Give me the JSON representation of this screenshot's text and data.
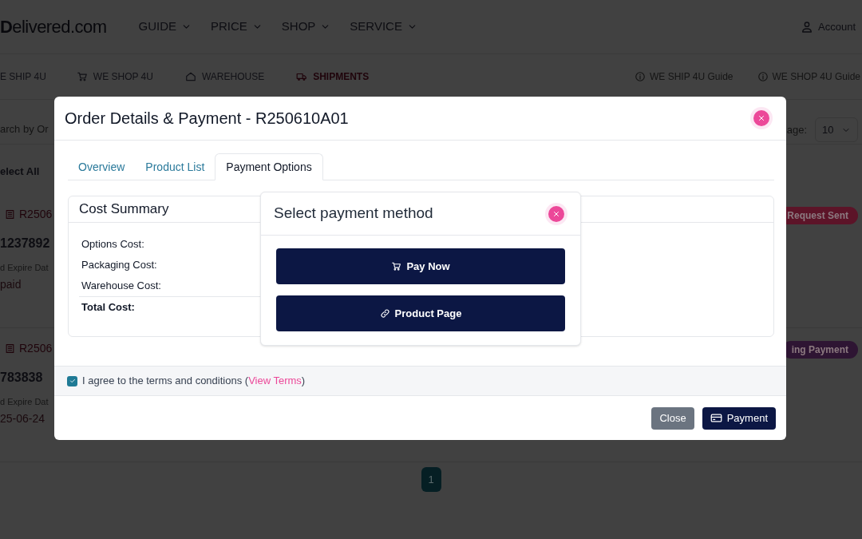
{
  "site_header": {
    "logo": "**D**elivered.com",
    "nav": [
      {
        "label": "GUIDE"
      },
      {
        "label": "PRICE"
      },
      {
        "label": "SHOP"
      },
      {
        "label": "SERVICE"
      }
    ],
    "account": "Account"
  },
  "sub_nav": {
    "items": [
      {
        "label": "E SHIP 4U",
        "selected": false
      },
      {
        "label": "WE SHOP 4U",
        "selected": false
      },
      {
        "label": "WAREHOUSE",
        "selected": false
      },
      {
        "label": "SHIPMENTS",
        "selected": true
      }
    ],
    "guides": [
      {
        "label": "WE SHIP 4U Guide"
      },
      {
        "label": "WE SHOP 4U Guide"
      }
    ]
  },
  "toolbar": {
    "search_placeholder": "arch by Or",
    "per_page_label": "age:",
    "per_page": "10",
    "select_all": "elect All"
  },
  "orders": [
    {
      "id": "R2506",
      "number": "1237892",
      "expire_label": "d Expire Dat",
      "expire_value": "paid",
      "status": "Request Sent",
      "color": "#5c1428"
    },
    {
      "id": "R2506",
      "number": "783838",
      "expire_label": "d Expire Dat",
      "expire_value": "25-06-24",
      "status": "ing Payment",
      "color": "#2e1533"
    }
  ],
  "pagination": [
    {
      "label": "1",
      "selected": true
    }
  ],
  "modal": {
    "title": "Order Details & Payment - R250610A01",
    "tabs": [
      {
        "label": "Overview",
        "selected": false
      },
      {
        "label": "Product List",
        "selected": false
      },
      {
        "label": "Payment Options",
        "selected": true
      }
    ],
    "cost_summary": {
      "title": "Cost Summary",
      "rows": [
        {
          "label": "Options Cost:",
          "total": false
        },
        {
          "label": "Packaging Cost:",
          "total": false
        },
        {
          "label": "Warehouse Cost:",
          "total": false
        },
        {
          "label": "Total Cost:",
          "total": true
        }
      ]
    },
    "agree": {
      "checked": true,
      "text": "I agree to the terms and conditions (",
      "link": "View Terms",
      "after": ")"
    },
    "buttons": [
      {
        "label": "Close",
        "kind": "secondary"
      },
      {
        "label": "Payment",
        "kind": "primary"
      }
    ]
  },
  "payment_popup": {
    "title": "Select payment method",
    "options": [
      {
        "label": "Pay Now"
      },
      {
        "label": "Product Page"
      }
    ]
  }
}
